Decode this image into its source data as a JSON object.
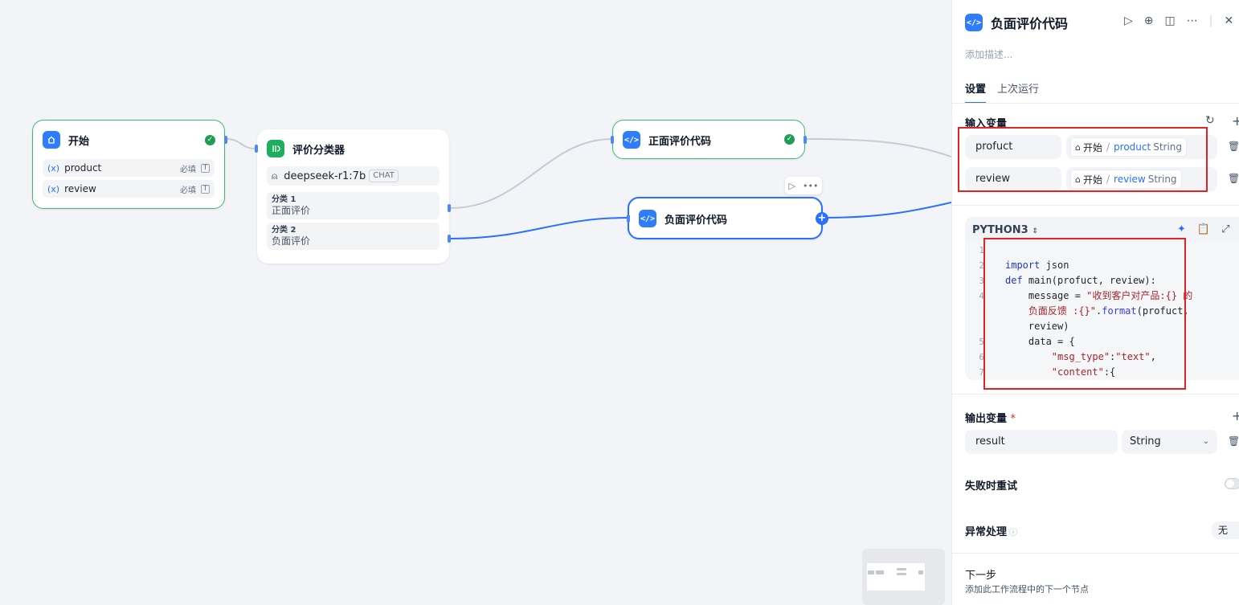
{
  "nodes": {
    "start": {
      "title": "开始",
      "vars": [
        {
          "name": "product",
          "required": "必填",
          "icon": "(x)"
        },
        {
          "name": "review",
          "required": "必填",
          "icon": "(x)"
        }
      ]
    },
    "classifier": {
      "title": "评价分类器",
      "model": "deepseek-r1:7b",
      "model_tag": "CHAT",
      "classes": [
        {
          "key": "分类 1",
          "value": "正面评价"
        },
        {
          "key": "分类 2",
          "value": "负面评价"
        }
      ]
    },
    "positive": {
      "title": "正面评价代码"
    },
    "negative": {
      "title": "负面评价代码"
    }
  },
  "panel": {
    "title": "负面评价代码",
    "description_placeholder": "添加描述...",
    "tabs": [
      "设置",
      "上次运行"
    ],
    "input_section": "输入变量",
    "inputs": [
      {
        "name": "profuct",
        "node": "开始",
        "var": "product",
        "type": "String"
      },
      {
        "name": "review",
        "node": "开始",
        "var": "review",
        "type": "String"
      }
    ],
    "code": {
      "language": "PYTHON3",
      "line_numbers": [
        "1",
        "2",
        "3",
        "4",
        "",
        "",
        "5",
        "6",
        "7"
      ]
    },
    "output_section": "输出变量",
    "output_required_mark": "*",
    "output": {
      "name": "result",
      "type": "String"
    },
    "retry_label": "失败时重试",
    "error_label": "异常处理",
    "error_value": "无",
    "next_title": "下一步",
    "next_desc": "添加此工作流程中的下一个节点"
  },
  "icons": {
    "run": "play-icon",
    "locate": "crosshair-icon",
    "split": "book-icon",
    "more": "more-icon",
    "close": "close-icon"
  },
  "colors": {
    "accent": "#2970ff",
    "success": "#1f9d55",
    "highlight": "#e02424"
  }
}
